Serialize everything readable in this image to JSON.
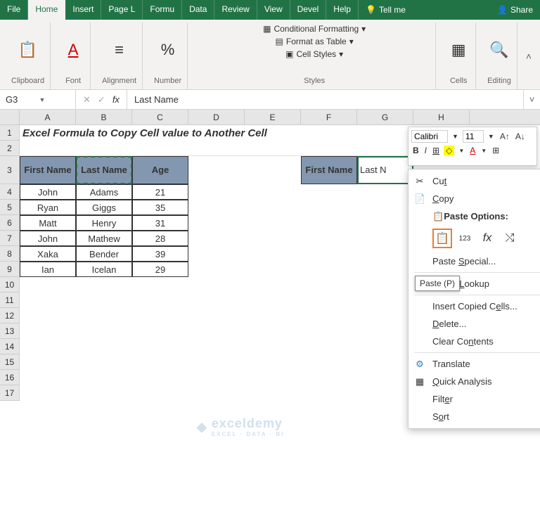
{
  "titlebar": {
    "tabs": [
      "File",
      "Home",
      "Insert",
      "Page L",
      "Formu",
      "Data",
      "Review",
      "View",
      "Devel",
      "Help"
    ],
    "active_index": 1,
    "tellme": "Tell me",
    "share": "Share"
  },
  "ribbon": {
    "clipboard": "Clipboard",
    "font": "Font",
    "alignment": "Alignment",
    "number": "Number",
    "styles": "Styles",
    "styles_items": {
      "cond": "Conditional Formatting",
      "table": "Format as Table",
      "cell": "Cell Styles"
    },
    "cells": "Cells",
    "editing": "Editing"
  },
  "formula": {
    "namebox": "G3",
    "value": "Last Name"
  },
  "columns": [
    "A",
    "B",
    "C",
    "D",
    "E",
    "F",
    "G",
    "H"
  ],
  "rownums": [
    "1",
    "2",
    "3",
    "4",
    "5",
    "6",
    "7",
    "8",
    "9",
    "10",
    "11",
    "12",
    "13",
    "14",
    "15",
    "16",
    "17"
  ],
  "title_text": "Excel Formula to Copy Cell value to Another Cell",
  "table": {
    "headers": [
      "First Name",
      "Last Name",
      "Age"
    ],
    "rows": [
      [
        "John",
        "Adams",
        "21"
      ],
      [
        "Ryan",
        "Giggs",
        "35"
      ],
      [
        "Matt",
        "Henry",
        "31"
      ],
      [
        "John",
        "Mathew",
        "28"
      ],
      [
        "Xaka",
        "Bender",
        "39"
      ],
      [
        "Ian",
        "Icelan",
        "29"
      ]
    ]
  },
  "dest": {
    "header": "First Name",
    "partial": "Last N"
  },
  "minibar": {
    "font": "Calibri",
    "size": "11"
  },
  "ctx": {
    "cut": "Cut",
    "copy": "Copy",
    "paste_head": "Paste Options:",
    "paste_special": "Paste Special...",
    "smart": "Smart Lookup",
    "insert": "Insert Copied Cells...",
    "delete": "Delete...",
    "clear": "Clear Contents",
    "translate": "Translate",
    "quick": "Quick Analysis",
    "filter": "Filter",
    "sort": "Sort",
    "tooltip": "Paste (P)"
  },
  "watermark": {
    "name": "exceldemy",
    "tag": "EXCEL · DATA · BI"
  }
}
